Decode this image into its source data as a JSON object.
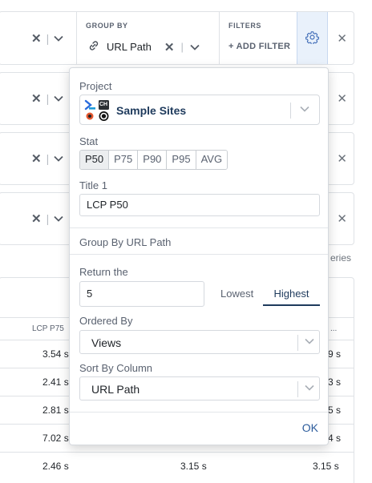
{
  "query_rows": {
    "group_by_header": "GROUP BY",
    "group_by_value": "URL Path",
    "filters_header": "FILTERS",
    "add_filter_label": "+ ADD FILTER",
    "clear_glyph": "✕",
    "divider_glyph": "|",
    "chevron_glyph": "⌄",
    "close_glyph": "✕",
    "series_label": "eries"
  },
  "table": {
    "headers": [
      "LCP P75",
      "..."
    ],
    "rows": [
      [
        "3.54 s",
        "9 s"
      ],
      [
        "2.41 s",
        "3 s"
      ],
      [
        "2.81 s",
        "5 s"
      ],
      [
        "7.02 s",
        "4 s"
      ],
      [
        "2.46 s",
        "3.15 s",
        "3.15 s"
      ]
    ]
  },
  "popover": {
    "project_label": "Project",
    "project_name": "Sample Sites",
    "logo_ch": "CH",
    "stat_label": "Stat",
    "stats": [
      "P50",
      "P75",
      "P90",
      "P95",
      "AVG"
    ],
    "active_stat": "P50",
    "title_label": "Title 1",
    "title_value": "LCP P50",
    "group_by_text": "Group By URL Path",
    "return_label": "Return the",
    "return_value": "5",
    "lowest_label": "Lowest",
    "highest_label": "Highest",
    "ordered_by_label": "Ordered By",
    "ordered_by_value": "Views",
    "sort_by_label": "Sort By Column",
    "sort_by_value": "URL Path",
    "ok_label": "OK"
  },
  "colors": {
    "accent": "#1e3a5c",
    "link": "#2c5c9c",
    "gear_bg": "#e9f1fb"
  }
}
